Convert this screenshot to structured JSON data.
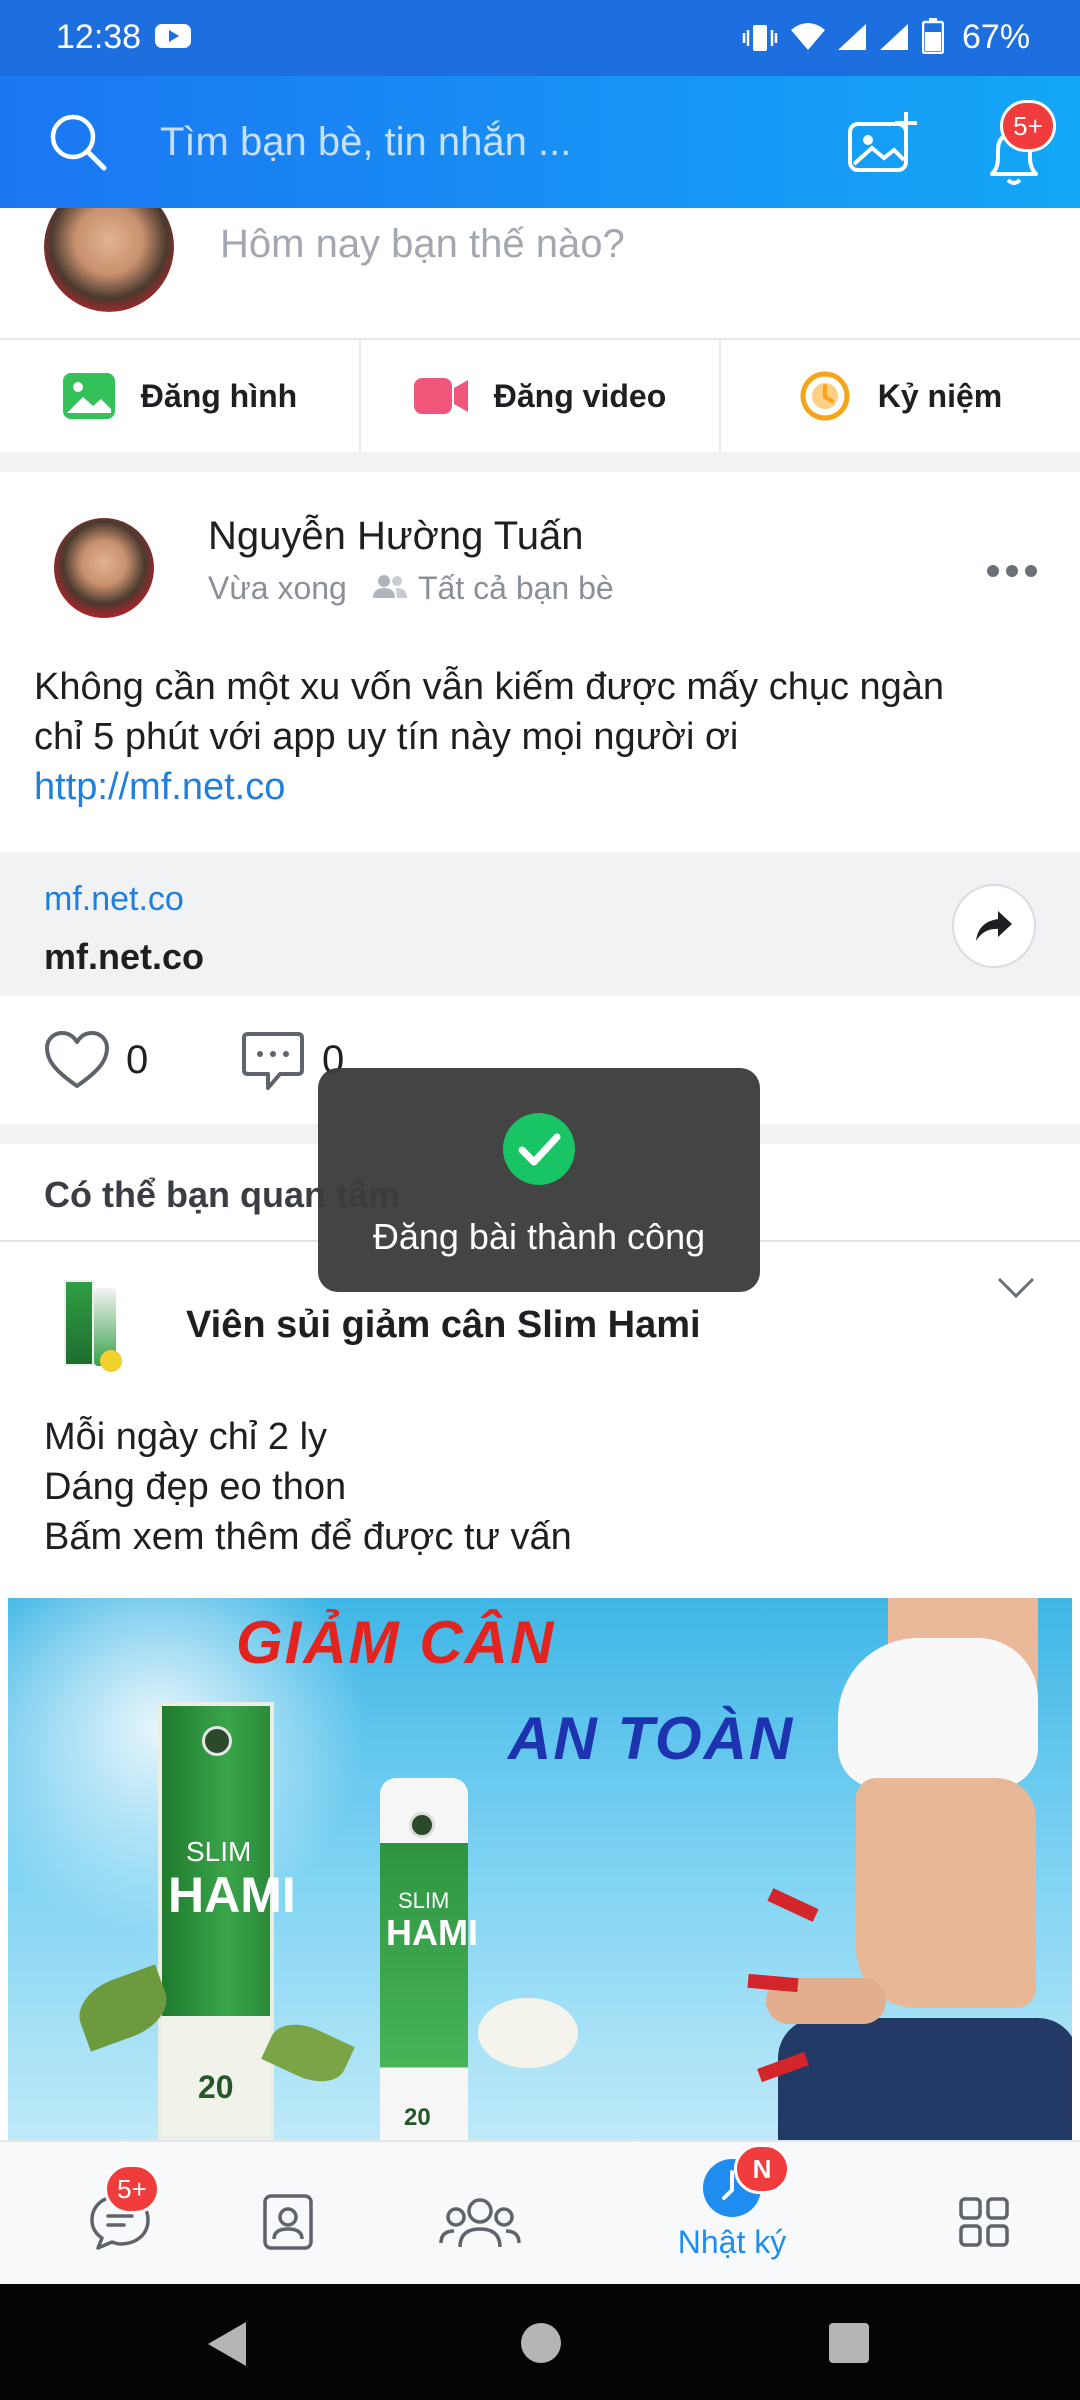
{
  "status": {
    "time": "12:38",
    "battery": "67%"
  },
  "header": {
    "search_placeholder": "Tìm bạn bè, tin nhắn ...",
    "notif_badge": "5+"
  },
  "composer": {
    "prompt": "Hôm nay bạn thế nào?",
    "actions": [
      "Đăng hình",
      "Đăng video",
      "Kỷ niệm"
    ]
  },
  "post": {
    "author": "Nguyễn Hường Tuấn",
    "time": "Vừa xong",
    "privacy": "Tất cả bạn bè",
    "text_line1": "Không cần một xu vốn vẫn kiếm được mấy chục ngàn",
    "text_line2": "chỉ 5 phút với app uy tín này mọi người ơi",
    "link": "http://mf.net.co",
    "preview_domain": "mf.net.co",
    "preview_title": "mf.net.co",
    "likes": "0",
    "comments": "0"
  },
  "toast": {
    "message": "Đăng bài thành công"
  },
  "suggested": {
    "heading": "Có thể bạn quan tâm"
  },
  "ad": {
    "title": "Viên sủi giảm cân Slim Hami",
    "line1": "Mỗi ngày chỉ 2 ly",
    "line2": "Dáng đẹp eo thon",
    "line3": "Bấm xem thêm để được tư vấn",
    "banner_text1": "GIẢM CÂN",
    "banner_text2": "AN TOÀN",
    "product_brand1": "SLIM",
    "product_brand2": "HAMI",
    "product_count": "20"
  },
  "bottom_nav": {
    "messages_badge": "5+",
    "timeline_label": "Nhật ký",
    "timeline_badge": "N"
  }
}
